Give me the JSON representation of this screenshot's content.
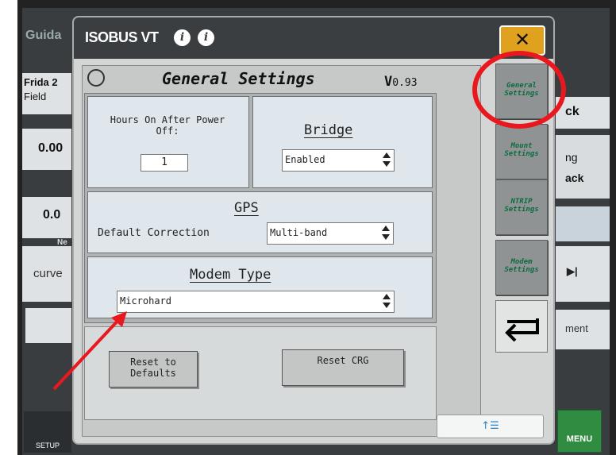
{
  "background": {
    "left_title": "Guida",
    "frida_label": "Frida 2",
    "field_label": "Field",
    "value_1": "0.00",
    "value_2": "0.0",
    "next_label": "Ne",
    "curve_label": "curve",
    "right_ck": "ck",
    "right_ng": "ng",
    "right_ack": "ack",
    "right_play": "▶|",
    "right_ment": "ment",
    "setup_label": "SETUP",
    "menu_label": "MENU"
  },
  "dialog": {
    "title": "ISOBUS VT",
    "close_symbol": "✕",
    "vt_title": "General Settings",
    "version_v": "V",
    "version_num": "0.93",
    "hours_label": "Hours On After Power Off:",
    "hours_value": "1",
    "bridge_label": "Bridge",
    "bridge_value": "Enabled",
    "gps_label": "GPS",
    "default_correction_label": "Default Correction",
    "default_correction_value": "Multi-band",
    "modem_type_label": "Modem Type",
    "modem_type_value": "Microhard",
    "reset_defaults_label": "Reset to Defaults",
    "reset_crg_label": "Reset CRG"
  },
  "softkeys": [
    {
      "label": "General Settings"
    },
    {
      "label": "Mount Settings"
    },
    {
      "label": "NTRIP Settings"
    },
    {
      "label": "Modem Settings"
    }
  ],
  "bottom_bar": {
    "list_icon_label": "↑☰"
  },
  "colors": {
    "close_button": "#e0a21e",
    "annotation_red": "#e8181e",
    "softkey_text": "#0d6b3e",
    "menu_green": "#2f8c41"
  }
}
